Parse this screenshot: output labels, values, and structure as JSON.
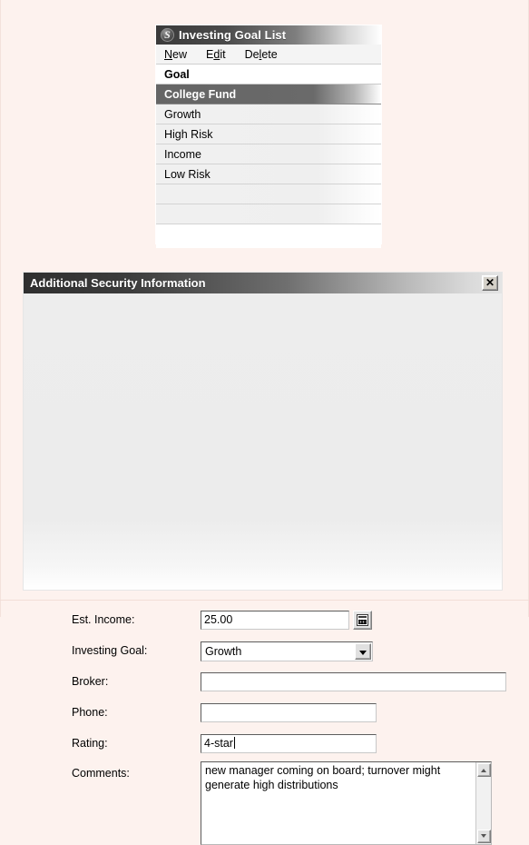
{
  "goal_window": {
    "title": "Investing Goal List",
    "icon": "quicken-s-icon",
    "menu": [
      {
        "label": "New",
        "accel": "N"
      },
      {
        "label": "Edit",
        "accel": "d"
      },
      {
        "label": "Delete",
        "accel": "l"
      }
    ],
    "column_header": "Goal",
    "rows": [
      {
        "label": "College Fund",
        "selected": true
      },
      {
        "label": "Growth",
        "selected": false
      },
      {
        "label": "High Risk",
        "selected": false
      },
      {
        "label": "Income",
        "selected": false
      },
      {
        "label": "Low Risk",
        "selected": false
      },
      {
        "label": "",
        "selected": false
      },
      {
        "label": "",
        "selected": false
      }
    ]
  },
  "dialog": {
    "title": "Additional Security Information",
    "close_label": "✕",
    "fields": {
      "est_income": {
        "label": "Est. Income:",
        "value": "25.00",
        "placeholder": "",
        "calc_button": "calculator-icon"
      },
      "investing_goal": {
        "label_pre": "Investin",
        "label_accel": "g",
        "label_post": " Goal:",
        "value": "Growth",
        "options": [
          "College Fund",
          "Growth",
          "High Risk",
          "Income",
          "Low Risk"
        ]
      },
      "broker": {
        "label": "Broker:",
        "value": "",
        "placeholder": ""
      },
      "phone": {
        "label": "Phone:",
        "value": "",
        "placeholder": ""
      },
      "rating": {
        "label": "Rating:",
        "value": "4-star",
        "placeholder": ""
      },
      "comments": {
        "label": "Comments:",
        "value": "new manager coming on board; turnover might generate high distributions",
        "placeholder": ""
      }
    }
  },
  "colors": {
    "page_background": "#fdf2ee",
    "dialog_background": "#ececec",
    "titlebar_dark": "#2f2f2f",
    "selection": "#656565",
    "field_background": "#ffffff",
    "text": "#000000"
  }
}
